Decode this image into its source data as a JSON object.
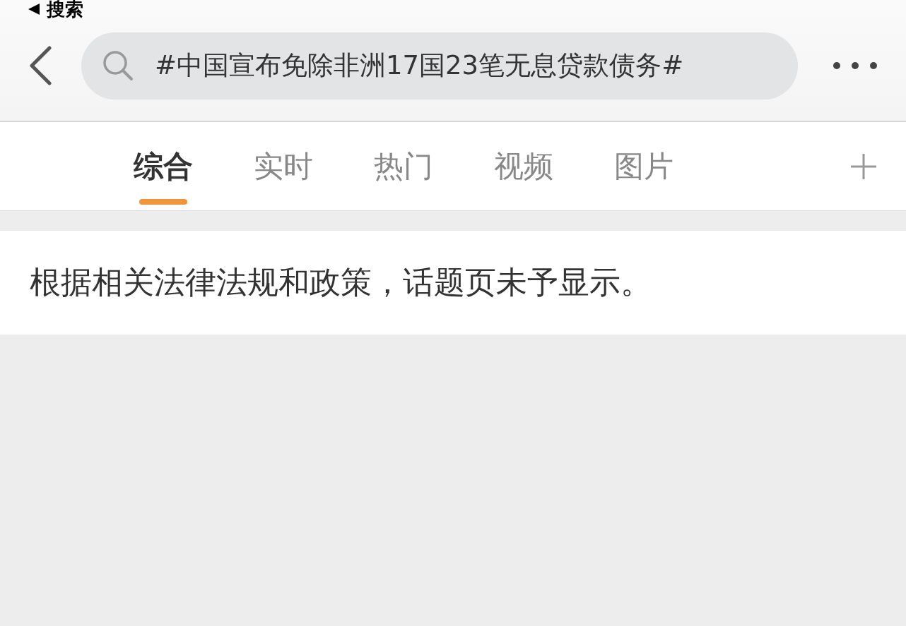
{
  "status_bar": {
    "back_label": "搜索"
  },
  "search": {
    "value": "#中国宣布免除非洲17国23笔无息贷款债务#"
  },
  "tabs": [
    {
      "label": "综合",
      "selected": true
    },
    {
      "label": "实时",
      "selected": false
    },
    {
      "label": "热门",
      "selected": false
    },
    {
      "label": "视频",
      "selected": false
    },
    {
      "label": "图片",
      "selected": false
    }
  ],
  "notice": "根据相关法律法规和政策，话题页未予显示。"
}
